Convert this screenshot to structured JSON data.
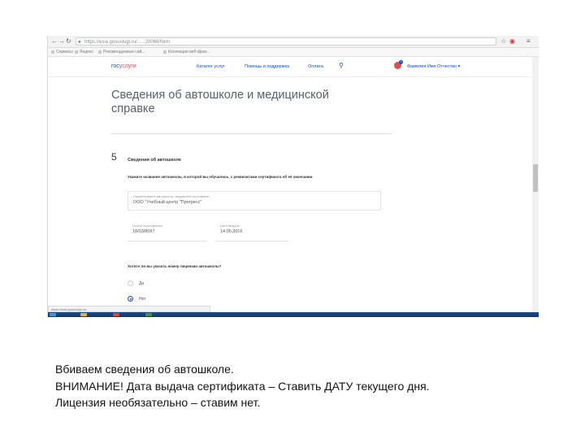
{
  "browser": {
    "url": "https://esia.gosuslugi.ru/......20068/form",
    "bookmarks": [
      "Сервисы",
      "Яндекс",
      "Рекомендуемые сай...",
      "Коллекция веб-фраг..."
    ],
    "status_url": "https://esia.gosuslugi.ru/..."
  },
  "site": {
    "logo_prefix": "гос",
    "logo_suffix": "услуги",
    "nav": [
      "Каталог услуг",
      "Помощь и поддержка",
      "Оплата"
    ],
    "user_name": "Фамилия Имя Отчество",
    "badge": "1"
  },
  "form": {
    "title": "Сведения об автошколе и медицинской справке",
    "step_number": "5",
    "step_title": "Сведения об автошколе",
    "hint": "Укажите название автошколы, в которой вы обучались, с реквизитами сертификата об её окончании",
    "school_field": {
      "label": "Наименование автошколы, выдавшей сертификат",
      "value": "ООО \"Учебный центр \"Прогресс\""
    },
    "cert_number_field": {
      "label": "Номер сертификата",
      "value": "18/03/8097"
    },
    "date_field": {
      "label": "Дата выдачи",
      "value": "14.05.2016"
    },
    "license_question": "Хотите ли вы указать номер лицензии автошколы?",
    "options": [
      {
        "label": "Да",
        "selected": false
      },
      {
        "label": "Нет",
        "selected": true
      }
    ]
  },
  "caption": {
    "line1": "Вбиваем сведения об автошколе.",
    "line2": "ВНИМАНИЕ! Дата выдача сертификата – Ставить ДАТУ текущего дня.",
    "line3": "Лицензия необязательно – ставим нет."
  },
  "colors": {
    "accent": "#0d4cd3",
    "brand_red": "#ee3f58",
    "title_gray": "#56606b"
  }
}
